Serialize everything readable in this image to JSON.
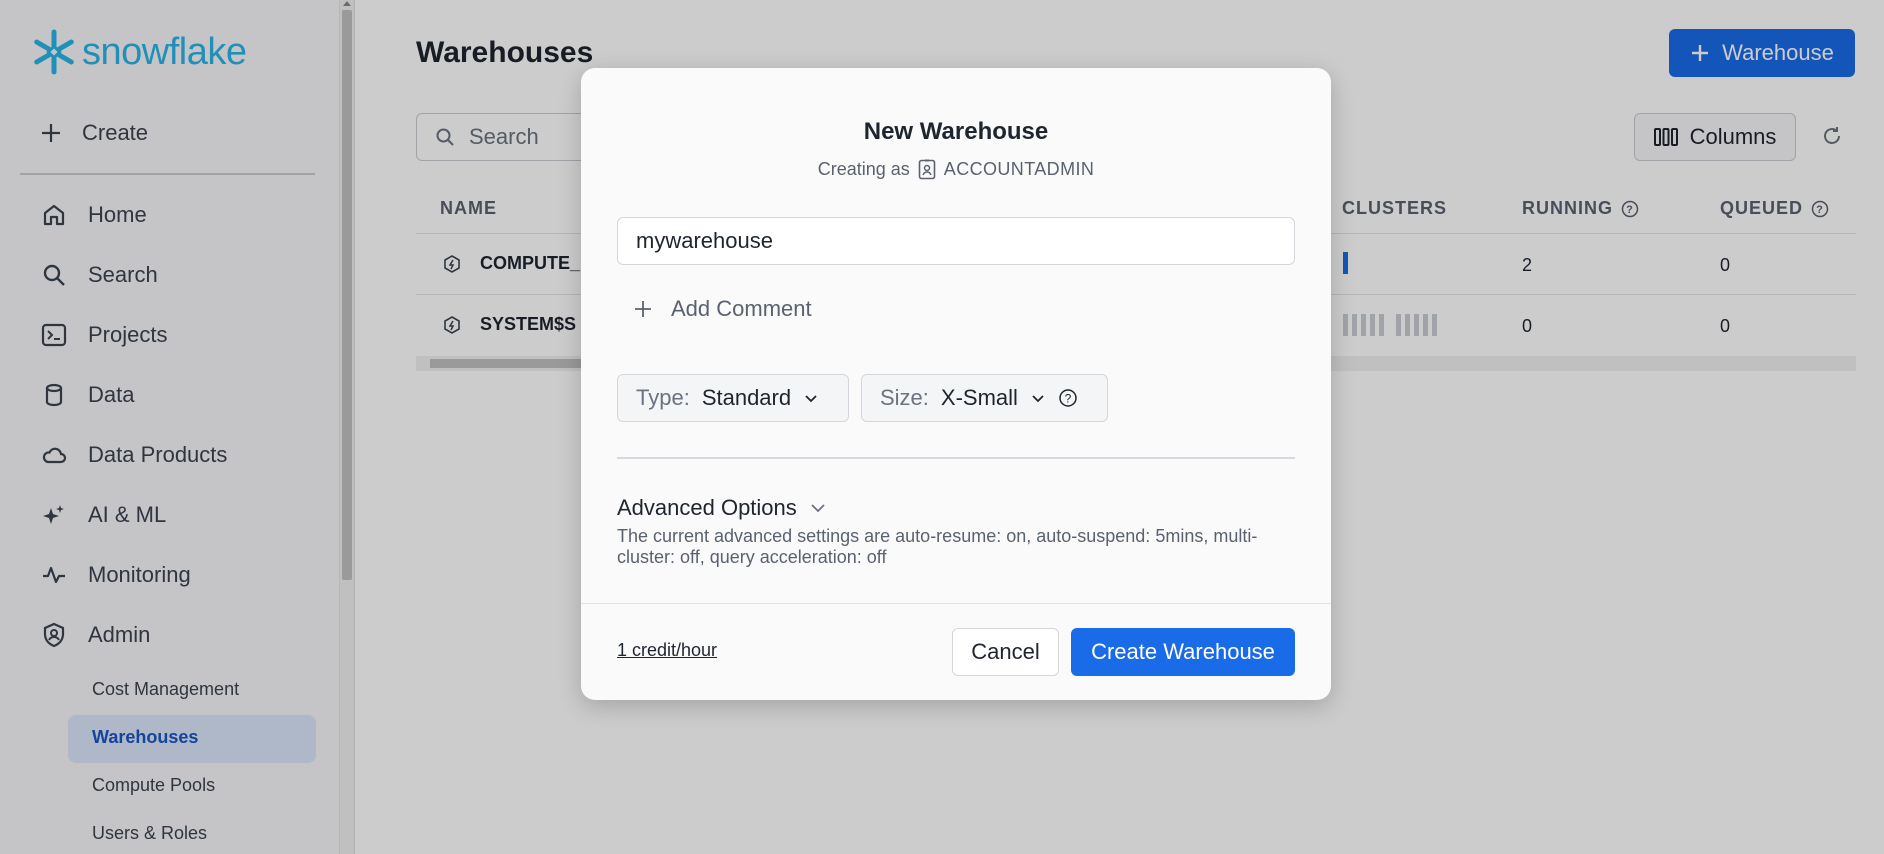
{
  "brand": {
    "name": "snowflake",
    "color": "#29b5e8"
  },
  "sidebar": {
    "create_label": "Create",
    "items": [
      {
        "label": "Home",
        "icon": "home-icon"
      },
      {
        "label": "Search",
        "icon": "search-icon"
      },
      {
        "label": "Projects",
        "icon": "terminal-icon"
      },
      {
        "label": "Data",
        "icon": "database-icon"
      },
      {
        "label": "Data Products",
        "icon": "cloud-icon"
      },
      {
        "label": "AI & ML",
        "icon": "sparkle-icon"
      },
      {
        "label": "Monitoring",
        "icon": "activity-icon"
      },
      {
        "label": "Admin",
        "icon": "shield-icon"
      }
    ],
    "admin_sub": [
      "Cost Management",
      "Warehouses",
      "Compute Pools",
      "Users & Roles"
    ],
    "active_sub": "Warehouses"
  },
  "main": {
    "title": "Warehouses",
    "add_button": "Warehouse",
    "search_placeholder": "Search",
    "columns_button": "Columns",
    "table": {
      "headers": {
        "name": "NAME",
        "clusters": "CLUSTERS",
        "running": "RUNNING",
        "queued": "QUEUED"
      },
      "rows": [
        {
          "name": "COMPUTE_",
          "running": "2",
          "queued": "0"
        },
        {
          "name": "SYSTEM$S",
          "running": "0",
          "queued": "0"
        }
      ]
    }
  },
  "modal": {
    "title": "New Warehouse",
    "creating_as_label": "Creating as",
    "role": "ACCOUNTADMIN",
    "name_value": "mywarehouse",
    "add_comment": "Add Comment",
    "type_label": "Type:",
    "type_value": "Standard",
    "size_label": "Size:",
    "size_value": "X-Small",
    "advanced_label": "Advanced Options",
    "advanced_desc": "The current advanced settings are auto-resume: on, auto-suspend: 5mins, multi-cluster: off, query acceleration: off",
    "credit": "1 credit/hour",
    "cancel": "Cancel",
    "create": "Create Warehouse"
  },
  "colors": {
    "primary": "#1a6be8",
    "active_nav_bg": "#dbe7fb"
  }
}
